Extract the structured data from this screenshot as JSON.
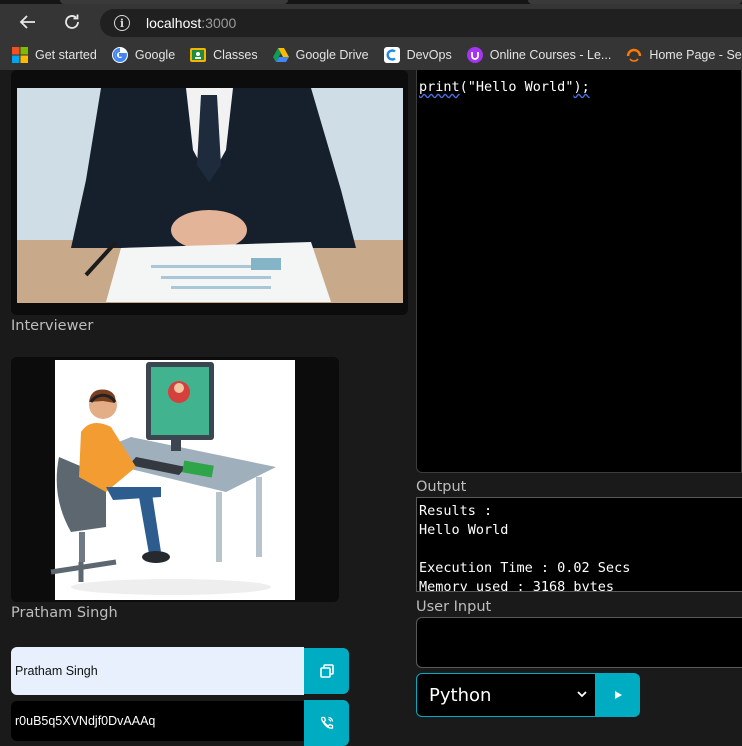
{
  "browser": {
    "url_host": "localhost",
    "url_port": ":3000",
    "bookmarks": [
      {
        "label": "Get started",
        "icon": "microsoft-logo-icon"
      },
      {
        "label": "Google",
        "icon": "google-logo-icon"
      },
      {
        "label": "Classes",
        "icon": "google-classroom-icon"
      },
      {
        "label": "Google Drive",
        "icon": "google-drive-icon"
      },
      {
        "label": "DevOps",
        "icon": "devops-icon"
      },
      {
        "label": "Online Courses - Le...",
        "icon": "udemy-icon"
      },
      {
        "label": "Home Page - Select",
        "icon": "loader-arc-icon"
      }
    ]
  },
  "interviewer": {
    "label": "Interviewer"
  },
  "candidate": {
    "label": "Pratham Singh"
  },
  "controls": {
    "name_value": "Pratham Singh",
    "room_id_value": "r0uB5q5XVNdjf0DvAAAq"
  },
  "editor": {
    "code_fn": "print",
    "code_open": "(",
    "code_string": "\"Hello World\"",
    "code_close": ");"
  },
  "output": {
    "label": "Output",
    "text": "Results :\nHello World\n\nExecution Time : 0.02 Secs\nMemory used : 3168 bytes"
  },
  "user_input": {
    "label": "User Input",
    "value": ""
  },
  "language": {
    "selected": "Python"
  },
  "colors": {
    "accent": "#00acc1",
    "background": "#1a1a1a"
  }
}
